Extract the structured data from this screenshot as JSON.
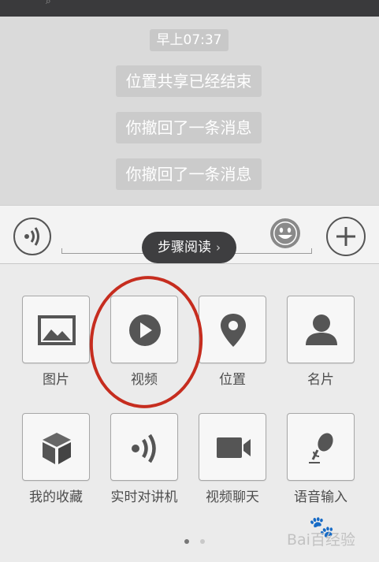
{
  "chat": {
    "time": "早上07:37",
    "messages": [
      "位置共享已经结束",
      "你撤回了一条消息",
      "你撤回了一条消息"
    ]
  },
  "input_bar": {
    "voice_icon": "voice-waves-icon",
    "emoji_icon": "smiley-icon",
    "plus_icon": "plus-icon"
  },
  "step_reading": {
    "label": "步骤阅读",
    "chevron": "›"
  },
  "panel": {
    "tiles": [
      {
        "label": "图片",
        "icon": "image-icon"
      },
      {
        "label": "视频",
        "icon": "video-play-icon"
      },
      {
        "label": "位置",
        "icon": "location-pin-icon"
      },
      {
        "label": "名片",
        "icon": "contact-card-icon"
      },
      {
        "label": "我的收藏",
        "icon": "favorites-box-icon"
      },
      {
        "label": "实时对讲机",
        "icon": "walkie-talkie-icon"
      },
      {
        "label": "视频聊天",
        "icon": "video-camera-icon"
      },
      {
        "label": "语音输入",
        "icon": "microphone-icon"
      }
    ],
    "page_indicator": {
      "current": 1,
      "total": 2
    }
  },
  "watermark": {
    "text": "Bai百经验"
  },
  "colors": {
    "annotation_ring": "#c62d1f",
    "step_pill_bg": "#3e3e40"
  }
}
